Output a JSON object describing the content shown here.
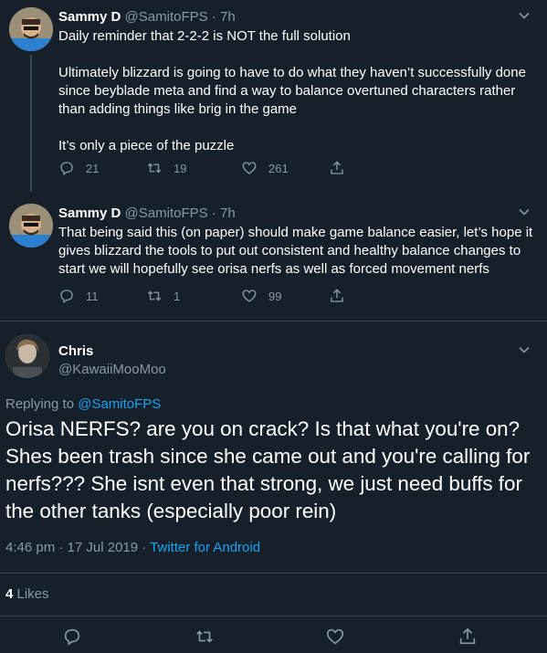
{
  "tweets": [
    {
      "name": "Sammy D",
      "handle": "@SamitoFPS",
      "time": "7h",
      "lines": [
        "Daily reminder that 2-2-2 is NOT the full solution",
        "",
        "Ultimately blizzard is going to have to do what they haven’t successfully done since beyblade meta and find a way to balance overtuned characters rather than adding things like brig in the game",
        "",
        "It’s only a piece of the puzzle"
      ],
      "replies": "21",
      "retweets": "19",
      "likes": "261"
    },
    {
      "name": "Sammy D",
      "handle": "@SamitoFPS",
      "time": "7h",
      "lines": [
        "That being said this (on paper) should make game balance easier, let’s hope it gives blizzard the tools to put out consistent and healthy balance changes to start we will hopefully see orisa nerfs as well as forced movement nerfs"
      ],
      "replies": "11",
      "retweets": "1",
      "likes": "99"
    }
  ],
  "main": {
    "name": "Chris",
    "handle": "@KawaiiMooMoo",
    "replying_prefix": "Replying to ",
    "replying_to": "@SamitoFPS",
    "text": "Orisa NERFS? are you on crack? Is that what you're on? Shes been trash since she came out and you're calling for nerfs??? She isnt even that strong, we just need buffs for the other tanks (especially poor rein)",
    "timestamp": "4:46 pm · 17 Jul 2019 · ",
    "app": "Twitter for Android",
    "likes_count": "4",
    "likes_label": " Likes"
  },
  "colors": {
    "background": "#15202b",
    "muted": "#8899a6",
    "accent": "#1da1f2",
    "divider": "#38444d"
  },
  "icons": {
    "reply": "reply-icon",
    "retweet": "retweet-icon",
    "like": "heart-icon",
    "share": "share-icon",
    "more": "chevron-down-icon"
  }
}
